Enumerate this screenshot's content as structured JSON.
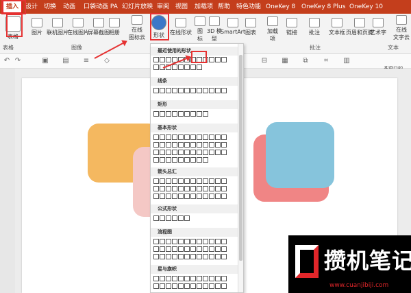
{
  "tabs": [
    "插入",
    "设计",
    "切换",
    "动画",
    "口袋动画 PA",
    "幻灯片放映",
    "审阅",
    "视图",
    "加载项",
    "帮助",
    "特色功能",
    "OneKey 8",
    "OneKey 8 Plus",
    "OneKey 10"
  ],
  "ribbon": {
    "table": "表格",
    "picture": "图片",
    "online_picture": "联机图片",
    "online_picture2": "在线图片",
    "screenshot": "屏幕截图",
    "album": "相册",
    "online_icon": "在线\n图标云",
    "shapes": "形状",
    "online_shape": "在线形状",
    "icon": "图\n标",
    "model3d": "3D 模\n型",
    "smartart": "SmartArt",
    "chart": "图表",
    "addins": "加载\n项",
    "link": "链接",
    "comment": "批注",
    "textbox": "文本框",
    "header_footer": "页眉和页脚",
    "art": "艺术字",
    "online_text": "在线\n文字云",
    "group_table": "表格",
    "group_image": "图像",
    "group_comment": "批注",
    "group_text": "文本"
  },
  "right_panel": "多窗口的",
  "gallery": {
    "sections": [
      "最近使用的形状",
      "线条",
      "矩形",
      "基本形状",
      "箭头总汇",
      "公式形状",
      "流程图",
      "星与旗帜"
    ]
  },
  "colors": {
    "ribbon_red": "#c43e1c",
    "highlight": "#e53232",
    "orange": "#f4b860",
    "pink": "#f4c8c5",
    "salmon": "#f08585",
    "blue": "#86c4dc"
  },
  "watermark": {
    "title": "攒机笔记",
    "url": "www.cuanjibiji.com"
  }
}
